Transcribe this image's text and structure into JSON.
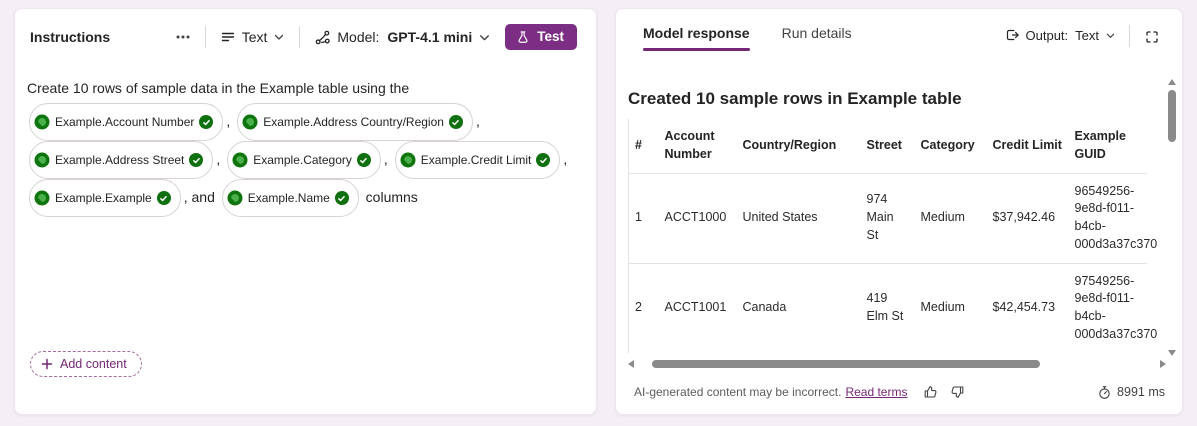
{
  "colors": {
    "page_bg": "#f6eef6",
    "accent": "#742774",
    "test_button": "#7b2e83",
    "check_green": "#0e700e",
    "dataverse_dark": "#0e750e",
    "dataverse_light": "#4ab04a",
    "scrollbar": "#8a8a8a",
    "text_primary": "#242424"
  },
  "left_panel": {
    "title": "Instructions",
    "format_value": "Text",
    "model_label": "Model:",
    "model_value": "GPT-4.1 mini",
    "test_label": "Test",
    "prompt_intro": "Create 10 rows of sample data in the Example table using the",
    "pills": [
      "Example.Account Number",
      "Example.Address Country/Region",
      "Example.Address Street",
      "Example.Category",
      "Example.Credit Limit",
      "Example.Example",
      "Example.Name"
    ],
    "separators": [
      ",",
      ",",
      ",",
      ",",
      ",",
      ", and",
      "columns"
    ],
    "add_content_label": "Add content",
    "icons": {
      "more": "ellipsis",
      "format": "text-align",
      "model": "flow-nodes",
      "test": "beaker",
      "pill_left": "dataverse",
      "pill_right": "checkmark",
      "add": "plus"
    }
  },
  "right_panel": {
    "tabs": [
      "Model response",
      "Run details"
    ],
    "output_label": "Output:",
    "output_value": "Text",
    "heading": "Created 10 sample rows in Example table",
    "table": {
      "headers": [
        "#",
        "Account Number",
        "Country/Region",
        "Street",
        "Category",
        "Credit Limit",
        "Example GUID"
      ],
      "rows": [
        [
          "1",
          "ACCT1000",
          "United States",
          "974 Main St",
          "Medium",
          "$37,942.46",
          "96549256-9e8d-f011-b4cb-000d3a37c370"
        ],
        [
          "2",
          "ACCT1001",
          "Canada",
          "419 Elm St",
          "Medium",
          "$42,454.73",
          "97549256-9e8d-f011-b4cb-000d3a37c370"
        ]
      ]
    },
    "footer": {
      "disclaimer": "AI-generated content may be incorrect.",
      "read_terms": "Read terms",
      "duration": "8991 ms"
    },
    "icons": {
      "output": "export-arrow",
      "expand": "fullscreen-brackets",
      "feedback_positive": "thumbs-up",
      "feedback_negative": "thumbs-down",
      "timer": "stopwatch"
    }
  }
}
